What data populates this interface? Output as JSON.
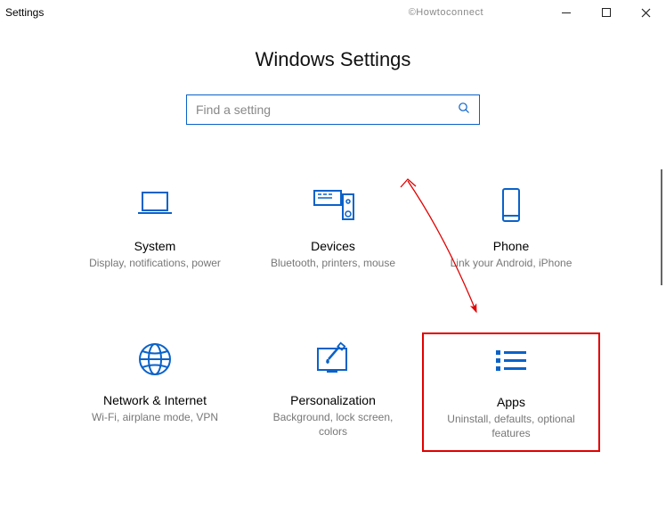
{
  "window": {
    "title": "Settings",
    "watermark": "©Howtoconnect"
  },
  "page": {
    "heading": "Windows Settings"
  },
  "search": {
    "placeholder": "Find a setting"
  },
  "tiles": [
    {
      "icon": "laptop-icon",
      "title": "System",
      "desc": "Display, notifications, power"
    },
    {
      "icon": "devices-icon",
      "title": "Devices",
      "desc": "Bluetooth, printers, mouse"
    },
    {
      "icon": "phone-icon",
      "title": "Phone",
      "desc": "Link your Android, iPhone"
    },
    {
      "icon": "globe-icon",
      "title": "Network & Internet",
      "desc": "Wi-Fi, airplane mode, VPN"
    },
    {
      "icon": "personalization-icon",
      "title": "Personalization",
      "desc": "Background, lock screen, colors"
    },
    {
      "icon": "apps-icon",
      "title": "Apps",
      "desc": "Uninstall, defaults, optional features"
    }
  ],
  "highlighted_tile_index": 5,
  "colors": {
    "accent": "#0a62c9",
    "highlight": "#e10000"
  }
}
